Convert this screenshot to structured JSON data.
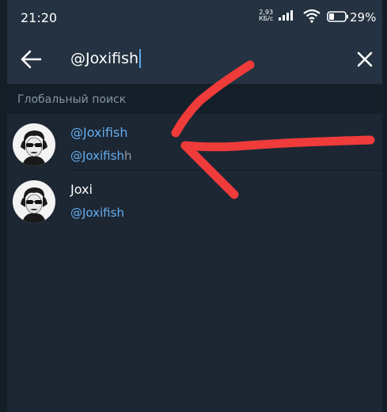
{
  "status_bar": {
    "time": "21:20",
    "net_speed_value": "2,93",
    "net_speed_unit": "КБ/с",
    "battery_percent": "29%"
  },
  "search": {
    "query": "@Joxifish",
    "back_icon": "arrow-left-icon",
    "clear_icon": "close-icon"
  },
  "section": {
    "title": "Глобальный поиск"
  },
  "results": [
    {
      "title": "@Joxifish",
      "subtitle_match": "@Joxifish",
      "subtitle_rest": "h"
    },
    {
      "title": "Joxi",
      "subtitle_match": "@Joxifish",
      "subtitle_rest": ""
    }
  ],
  "annotation": {
    "arrow_color": "#f03b3b"
  },
  "colors": {
    "accent": "#65adf0",
    "header_bg": "#243241",
    "list_bg": "#1d2733",
    "section_bg": "#151f2a"
  }
}
